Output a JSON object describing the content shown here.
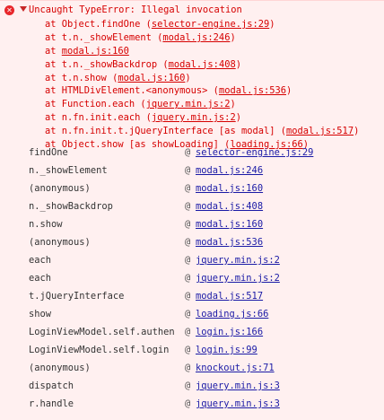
{
  "error": {
    "icon": "error-icon",
    "message": "Uncaught TypeError: Illegal invocation",
    "stack": [
      {
        "prefix": "at Object.findOne (",
        "link": "selector-engine.js:29",
        "suffix": ")"
      },
      {
        "prefix": "at t.n._showElement (",
        "link": "modal.js:246",
        "suffix": ")"
      },
      {
        "prefix": "at ",
        "link": "modal.js:160",
        "suffix": ""
      },
      {
        "prefix": "at t.n._showBackdrop (",
        "link": "modal.js:408",
        "suffix": ")"
      },
      {
        "prefix": "at t.n.show (",
        "link": "modal.js:160",
        "suffix": ")"
      },
      {
        "prefix": "at HTMLDivElement.<anonymous> (",
        "link": "modal.js:536",
        "suffix": ")"
      },
      {
        "prefix": "at Function.each (",
        "link": "jquery.min.js:2",
        "suffix": ")"
      },
      {
        "prefix": "at n.fn.init.each (",
        "link": "jquery.min.js:2",
        "suffix": ")"
      },
      {
        "prefix": "at n.fn.init.t.jQueryInterface [as modal] (",
        "link": "modal.js:517",
        "suffix": ")"
      },
      {
        "prefix": "at Object.show [as showLoading] (",
        "link": "loading.js:66",
        "suffix": ")"
      }
    ]
  },
  "call_stack": [
    {
      "fn": "findOne",
      "at": "@",
      "src": "selector-engine.js:29"
    },
    {
      "fn": "n._showElement",
      "at": "@",
      "src": "modal.js:246"
    },
    {
      "fn": "(anonymous)",
      "at": "@",
      "src": "modal.js:160"
    },
    {
      "fn": "n._showBackdrop",
      "at": "@",
      "src": "modal.js:408"
    },
    {
      "fn": "n.show",
      "at": "@",
      "src": "modal.js:160"
    },
    {
      "fn": "(anonymous)",
      "at": "@",
      "src": "modal.js:536"
    },
    {
      "fn": "each",
      "at": "@",
      "src": "jquery.min.js:2"
    },
    {
      "fn": "each",
      "at": "@",
      "src": "jquery.min.js:2"
    },
    {
      "fn": "t.jQueryInterface",
      "at": "@",
      "src": "modal.js:517"
    },
    {
      "fn": "show",
      "at": "@",
      "src": "loading.js:66"
    },
    {
      "fn": "LoginViewModel.self.authen",
      "at": "@",
      "src": "login.js:166"
    },
    {
      "fn": "LoginViewModel.self.login",
      "at": "@",
      "src": "login.js:99"
    },
    {
      "fn": "(anonymous)",
      "at": "@",
      "src": "knockout.js:71"
    },
    {
      "fn": "dispatch",
      "at": "@",
      "src": "jquery.min.js:3"
    },
    {
      "fn": "r.handle",
      "at": "@",
      "src": "jquery.min.js:3"
    }
  ]
}
